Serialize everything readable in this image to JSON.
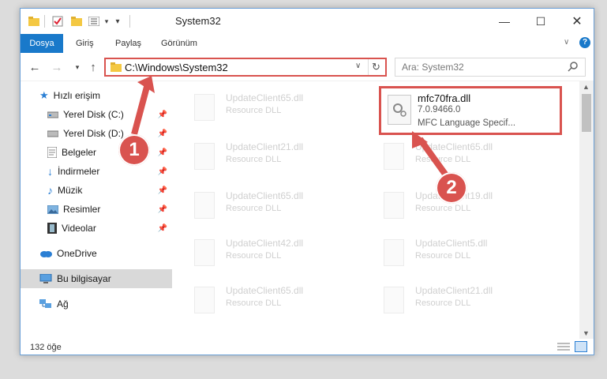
{
  "window": {
    "title": "System32",
    "quick_access": [
      "folder-icon",
      "properties-checkmark-icon",
      "new-folder-icon",
      "view-list-icon",
      "dropdown-arrow-icon"
    ]
  },
  "ribbon": {
    "tabs": [
      "Dosya",
      "Giriş",
      "Paylaş",
      "Görünüm"
    ]
  },
  "address": {
    "path": "C:\\Windows\\System32"
  },
  "search": {
    "placeholder": "Ara: System32"
  },
  "sidebar": {
    "items": [
      {
        "label": "Hızlı erişim"
      },
      {
        "label": "Yerel Disk (C:)"
      },
      {
        "label": "Yerel Disk (D:)"
      },
      {
        "label": "Belgeler"
      },
      {
        "label": "İndirmeler"
      },
      {
        "label": "Müzik"
      },
      {
        "label": "Resimler"
      },
      {
        "label": "Videolar"
      },
      {
        "label": "OneDrive"
      },
      {
        "label": "Bu bilgisayar"
      },
      {
        "label": "Ağ"
      }
    ]
  },
  "files": [
    {
      "name": "UpdateClient65.dll",
      "desc": "Resource DLL"
    },
    {
      "name": "mfc70fra.dll",
      "version": "7.0.9466.0",
      "desc": "MFC Language Specif..."
    },
    {
      "name": "UpdateClient21.dll",
      "desc": "Resource DLL"
    },
    {
      "name": "UpdateClient65.dll",
      "desc": "Resource DLL"
    },
    {
      "name": "UpdateClient65.dll",
      "desc": "Resource DLL"
    },
    {
      "name": "UpdateClient19.dll",
      "desc": "Resource DLL"
    },
    {
      "name": "UpdateClient42.dll",
      "desc": "Resource DLL"
    },
    {
      "name": "UpdateClient5.dll",
      "desc": "Resource DLL"
    },
    {
      "name": "UpdateClient65.dll",
      "desc": "Resource DLL"
    },
    {
      "name": "UpdateClient21.dll",
      "desc": "Resource DLL"
    }
  ],
  "status": {
    "count": "132 öğe"
  },
  "annotations": {
    "step1": "1",
    "step2": "2",
    "color": "#d9534f"
  }
}
